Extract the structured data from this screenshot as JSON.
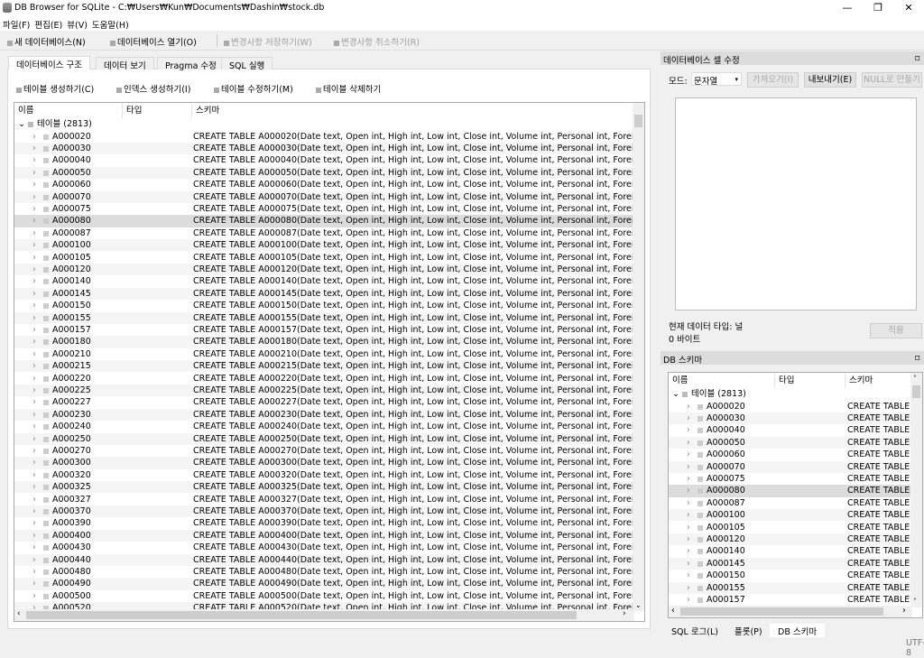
{
  "window": {
    "title": "DB Browser for SQLite - C:₩Users₩Kun₩Documents₩Dashin₩stock.db",
    "minimize": "—",
    "restore": "❐",
    "close": "✕"
  },
  "menu": [
    "파일(F)",
    "편집(E)",
    "뷰(V)",
    "도움말(H)"
  ],
  "toolbar": {
    "new_db": "새 데이터베이스(N)",
    "open_db": "데이터베이스 열기(O)",
    "write": "변경사항 저장하기(W)",
    "revert": "변경사항 취소하기(R)"
  },
  "tabs": [
    "데이터베이스 구조",
    "데이터 보기",
    "Pragma 수정",
    "SQL 실행"
  ],
  "structure_toolbar": {
    "create_table": "테이블 생성하기(C)",
    "create_index": "인덱스 생성하기(I)",
    "modify_table": "테이블 수정하기(M)",
    "delete_table": "테이블 삭제하기"
  },
  "columns": {
    "name": "이름",
    "type": "타입",
    "schema": "스키마"
  },
  "tables_group": "테이블 (2813)",
  "tables": [
    "A000020",
    "A000030",
    "A000040",
    "A000050",
    "A000060",
    "A000070",
    "A000075",
    "A000080",
    "A000087",
    "A000100",
    "A000105",
    "A000120",
    "A000140",
    "A000145",
    "A000150",
    "A000155",
    "A000157",
    "A000180",
    "A000210",
    "A000215",
    "A000220",
    "A000225",
    "A000227",
    "A000230",
    "A000240",
    "A000250",
    "A000270",
    "A000300",
    "A000320",
    "A000325",
    "A000327",
    "A000370",
    "A000390",
    "A000400",
    "A000430",
    "A000440",
    "A000480",
    "A000490",
    "A000500",
    "A000520"
  ],
  "selected_table": "A000080",
  "schema_template": "CREATE TABLE {name}(Date text, Open int, High int, Low int, Close int, Volume int, Personal int, Foreigner int, in",
  "schema_short": "CREATE TABLE ..",
  "cell_editor": {
    "title": "데이터베이스 셀 수정",
    "mode_label": "모드:",
    "mode_value": "문자열",
    "import": "가져오기(I)",
    "export": "내보내기(E)",
    "set_null": "NULL로 만들기",
    "type_info": "현재 데이터 타입: 널",
    "size_info": "0 바이트",
    "apply": "적용"
  },
  "db_schema": {
    "title": "DB 스키마",
    "visible_count": 17
  },
  "bottom_tabs": [
    "SQL 로그(L)",
    "플롯(P)",
    "DB 스키마"
  ],
  "status": {
    "encoding": "UTF-8"
  }
}
